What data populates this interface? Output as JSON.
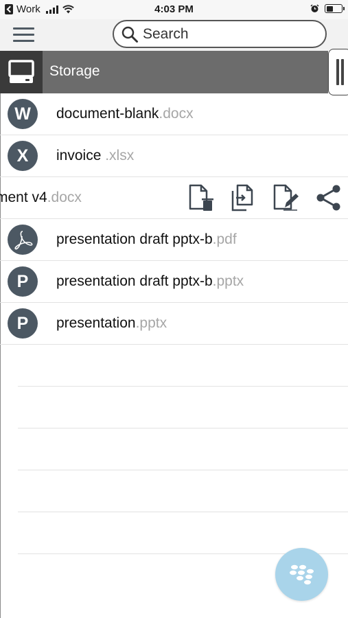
{
  "status_bar": {
    "back_app": "Work",
    "time": "4:03 PM",
    "icons": [
      "back-icon",
      "signal-bars-icon",
      "wifi-icon",
      "alarm-icon",
      "battery-icon"
    ]
  },
  "top_bar": {
    "menu_icon": "hamburger-icon",
    "search": {
      "placeholder": "Search",
      "icon": "search-icon"
    }
  },
  "storage": {
    "title": "Storage",
    "icon": "laptop-icon"
  },
  "files": [
    {
      "letter": "W",
      "name": "document-blank",
      "ext": ".docx",
      "icon": "word-icon"
    },
    {
      "letter": "X",
      "name": "invoice ",
      "ext": ".xlsx",
      "icon": "excel-icon"
    },
    {
      "letter": "",
      "name": "ment v4",
      "ext": ".docx",
      "icon": "",
      "swiped": true,
      "actions": [
        "delete-file-icon",
        "move-file-icon",
        "rename-file-icon",
        "share-icon"
      ]
    },
    {
      "letter": "",
      "name": "presentation draft pptx-b",
      "ext": ".pdf",
      "icon": "pdf-icon"
    },
    {
      "letter": "P",
      "name": "presentation draft pptx-b",
      "ext": ".pptx",
      "icon": "powerpoint-icon"
    },
    {
      "letter": "P",
      "name": "presentation",
      "ext": ".pptx",
      "icon": "powerpoint-icon"
    }
  ],
  "fab": {
    "icon": "blackberry-logo-icon"
  },
  "colors": {
    "header_bg": "#6c6c6c",
    "avatar_bg": "#4c5863",
    "ext_text": "#a6a6a6",
    "fab_bg": "#a9d4ea"
  }
}
